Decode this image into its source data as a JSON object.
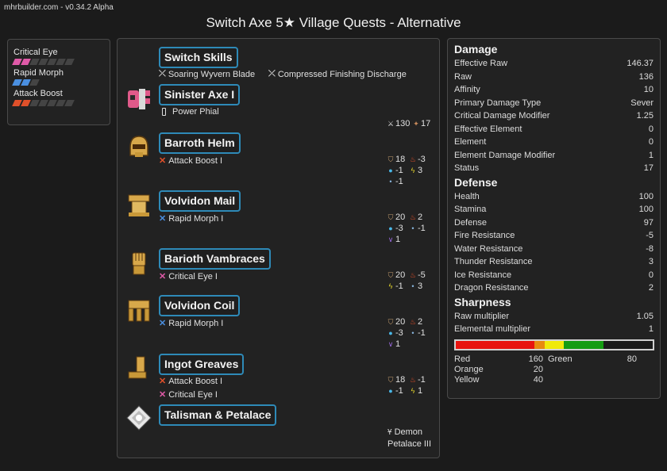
{
  "header": {
    "version": "mhrbuilder.com - v0.34.2 Alpha",
    "title": "Switch Axe 5★ Village Quests - Alternative"
  },
  "skills": [
    {
      "name": "Critical Eye",
      "filled": 2,
      "total": 7,
      "color": "#e05aa8"
    },
    {
      "name": "Rapid Morph",
      "filled": 2,
      "total": 3,
      "color": "#4a8fe0"
    },
    {
      "name": "Attack Boost",
      "filled": 2,
      "total": 7,
      "color": "#e0502a"
    }
  ],
  "equipment": {
    "switch_skills": {
      "name": "Switch Skills",
      "skill1": "Soaring Wyvern Blade",
      "skill2": "Compressed Finishing Discharge"
    },
    "weapon": {
      "name": "Sinister Axe I",
      "deco": "Power Phial",
      "attack": "130",
      "affinity": "17",
      "icon": "switch-axe-icon"
    },
    "helm": {
      "name": "Barroth Helm",
      "deco": "Attack Boost I",
      "defense": "18",
      "fire": "-3",
      "water": "-1",
      "thunder": "3",
      "ice": "-1",
      "icon": "helm-icon"
    },
    "mail": {
      "name": "Volvidon Mail",
      "deco": "Rapid Morph I",
      "defense": "20",
      "fire": "2",
      "water": "-3",
      "ice": "-1",
      "dragon": "1",
      "icon": "chest-icon"
    },
    "vambraces": {
      "name": "Barioth Vambraces",
      "deco": "Critical Eye I",
      "defense": "20",
      "fire": "-5",
      "thunder": "-1",
      "ice": "3",
      "icon": "arms-icon"
    },
    "coil": {
      "name": "Volvidon Coil",
      "deco": "Rapid Morph I",
      "defense": "20",
      "fire": "2",
      "water": "-3",
      "ice": "-1",
      "dragon": "1",
      "icon": "waist-icon"
    },
    "greaves": {
      "name": "Ingot Greaves",
      "deco1": "Attack Boost I",
      "deco2": "Critical Eye I",
      "defense": "18",
      "fire": "-1",
      "water": "-1",
      "thunder": "1",
      "icon": "legs-icon"
    },
    "talisman": {
      "name": "Talisman & Petalace",
      "petalace_line1": "Demon",
      "petalace_line2": "Petalace III",
      "icon": "talisman-icon"
    }
  },
  "stats": {
    "damage_title": "Damage",
    "damage": [
      {
        "label": "Effective Raw",
        "value": "146.37"
      },
      {
        "label": "Raw",
        "value": "136"
      },
      {
        "label": "Affinity",
        "value": "10"
      },
      {
        "label": "Primary Damage Type",
        "value": "Sever"
      },
      {
        "label": "Critical Damage Modifier",
        "value": "1.25"
      },
      {
        "label": "Effective Element",
        "value": "0"
      },
      {
        "label": "Element",
        "value": "0"
      },
      {
        "label": "Element Damage Modifier",
        "value": "1"
      },
      {
        "label": "Status",
        "value": "17"
      }
    ],
    "defense_title": "Defense",
    "defense": [
      {
        "label": "Health",
        "value": "100"
      },
      {
        "label": "Stamina",
        "value": "100"
      },
      {
        "label": "Defense",
        "value": "97"
      },
      {
        "label": "Fire Resistance",
        "value": "-5"
      },
      {
        "label": "Water Resistance",
        "value": "-8"
      },
      {
        "label": "Thunder Resistance",
        "value": "3"
      },
      {
        "label": "Ice Resistance",
        "value": "0"
      },
      {
        "label": "Dragon Resistance",
        "value": "2"
      }
    ],
    "sharpness_title": "Sharpness",
    "sharpness": [
      {
        "label": "Raw multiplier",
        "value": "1.05"
      },
      {
        "label": "Elemental multiplier",
        "value": "1"
      }
    ],
    "sharpness_bar": [
      {
        "name": "Red",
        "value": 160,
        "color": "#e8130f"
      },
      {
        "name": "Orange",
        "value": 20,
        "color": "#e88a0f"
      },
      {
        "name": "Yellow",
        "value": 40,
        "color": "#f0ea0a"
      },
      {
        "name": "Green",
        "value": 80,
        "color": "#159c12"
      }
    ],
    "sharpness_max": 400,
    "sharpness_labels": {
      "red": "Red",
      "red_v": "160",
      "green": "Green",
      "green_v": "80",
      "orange": "Orange",
      "orange_v": "20",
      "yellow": "Yellow",
      "yellow_v": "40"
    }
  },
  "colors": {
    "fire": "#e8502a",
    "water": "#4ab8e8",
    "thunder": "#e8d82a",
    "ice": "#8ab8e0",
    "dragon": "#9a6ae0",
    "critical_eye": "#e05aa8",
    "rapid_morph": "#4a8fe0",
    "attack_boost": "#e0502a"
  }
}
